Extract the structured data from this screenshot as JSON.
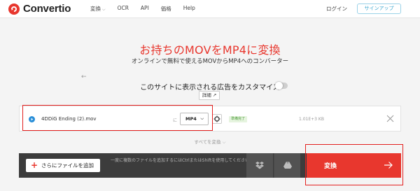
{
  "header": {
    "logo_text": "Convertio",
    "nav": [
      {
        "label": "変換",
        "has_dropdown": true
      },
      {
        "label": "OCR",
        "has_dropdown": false
      },
      {
        "label": "API",
        "has_dropdown": false
      },
      {
        "label": "価格",
        "has_dropdown": false
      },
      {
        "label": "Help",
        "has_dropdown": false
      }
    ],
    "login_label": "ログイン",
    "signup_label": "サインアップ"
  },
  "hero": {
    "title": "お持ちのMOVをMP4に変換",
    "subtitle": "オンラインで無料で使えるMOVからMP4へのコンバーター"
  },
  "ads": {
    "text": "このサイトに表示される広告をカスタマイズ",
    "toggle_on": false,
    "details_label": "詳細"
  },
  "file": {
    "name": "4DDiG Ending (2).mov",
    "to_label": "に",
    "format": "MP4",
    "status": "準備完了",
    "size": "1.01E+3 KB"
  },
  "convert_all_label": "すべてを変換",
  "bottom": {
    "add_files_label": "さらにファイルを追加",
    "hint": "一度に複数のファイルを追加するにはCtrlまたはShiftを使用してください",
    "convert_label": "変換"
  },
  "colors": {
    "accent": "#e8372e",
    "dark_bar": "#3c3c3c",
    "highlight": "#e3211f",
    "signup": "#3aa6cf",
    "status_green": "#4a9a36"
  }
}
